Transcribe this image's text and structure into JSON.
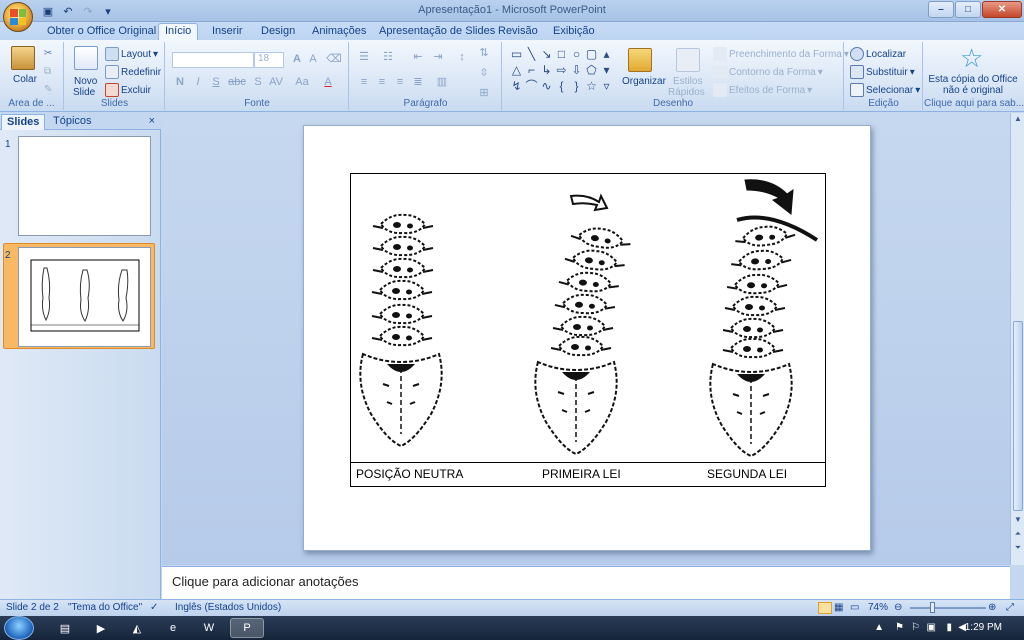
{
  "window": {
    "title": "Apresentação1 - Microsoft PowerPoint",
    "controls": [
      "minimize-icon",
      "maximize-icon",
      "close-icon"
    ]
  },
  "colors": {
    "ribbon": "#dbe7f6",
    "accent": "#15428b",
    "selected_thumb": "#f7b964"
  },
  "ribbon_tabs": [
    "Obter o Office Original",
    "Início",
    "Inserir",
    "Design",
    "Animações",
    "Apresentação de Slides",
    "Revisão",
    "Exibição"
  ],
  "active_tab": "Início",
  "ribbon": {
    "clipboard": {
      "paste": "Colar",
      "group": "Área de ..."
    },
    "slides": {
      "new_slide_1": "Novo",
      "new_slide_2": "Slide",
      "layout": "Layout",
      "reset": "Redefinir",
      "delete": "Excluir",
      "group": "Slides"
    },
    "font": {
      "size": "18",
      "bold": "N",
      "italic": "I",
      "underline": "S",
      "strike": "abc",
      "shadow": "S",
      "spacing": "AV",
      "case": "Aa",
      "color": "A",
      "grow": "A",
      "shrink": "A",
      "group": "Fonte"
    },
    "paragraph": {
      "group": "Parágrafo"
    },
    "drawing": {
      "arrange": "Organizar",
      "quick_styles_1": "Estilos",
      "quick_styles_2": "Rápidos",
      "fill": "Preenchimento da Forma",
      "outline": "Contorno da Forma",
      "effects": "Efeitos de Forma",
      "group": "Desenho"
    },
    "editing": {
      "find": "Localizar",
      "replace": "Substituir",
      "select": "Selecionar",
      "group": "Edição"
    },
    "office": {
      "line1": "Esta cópia do Office",
      "line2": "não é original",
      "group": "Clique aqui para sab..."
    }
  },
  "panel": {
    "tab_slides": "Slides",
    "tab_outline": "Tópicos",
    "close": "×",
    "thumbnails": [
      "1",
      "2"
    ],
    "selected": "2"
  },
  "slide": {
    "captions": [
      "POSIÇÃO NEUTRA",
      "PRIMEIRA LEI",
      "SEGUNDA LEI"
    ]
  },
  "notes_placeholder": "Clique para adicionar anotações",
  "status": {
    "slide": "Slide 2 de 2",
    "theme": "\"Tema do Office\"",
    "language": "Inglês (Estados Unidos)",
    "zoom": "74%"
  },
  "taskbar": {
    "clock": "1:29 PM"
  }
}
